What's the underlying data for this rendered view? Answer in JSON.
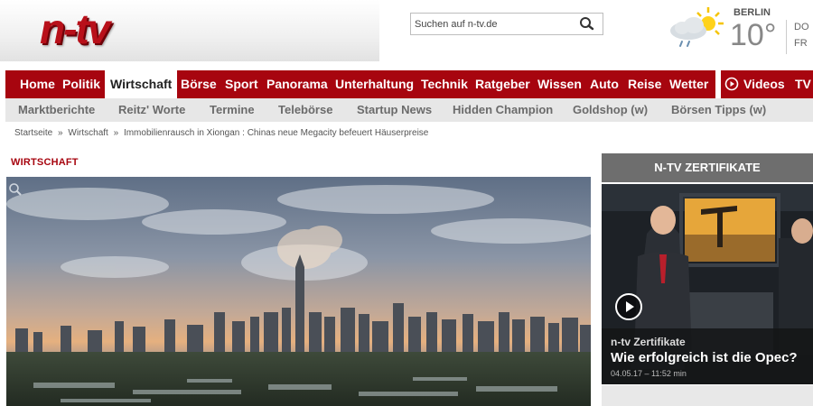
{
  "header": {
    "logo_text": "n-tv",
    "search": {
      "placeholder": "Suchen auf n-tv.de",
      "value": ""
    },
    "weather": {
      "city": "BERLIN",
      "temp": "10°",
      "day1": "DO",
      "day2": "FR",
      "icon": "partly-cloudy-rain-icon"
    }
  },
  "nav": {
    "items": [
      {
        "label": "Home"
      },
      {
        "label": "Politik"
      },
      {
        "label": "Wirtschaft",
        "active": true
      },
      {
        "label": "Börse"
      },
      {
        "label": "Sport"
      },
      {
        "label": "Panorama"
      },
      {
        "label": "Unterhaltung"
      },
      {
        "label": "Technik"
      },
      {
        "label": "Ratgeber"
      },
      {
        "label": "Wissen"
      },
      {
        "label": "Auto"
      },
      {
        "label": "Reise"
      },
      {
        "label": "Wetter"
      },
      {
        "label": "Videos"
      },
      {
        "label": "TV"
      }
    ]
  },
  "subnav": {
    "items": [
      {
        "label": "Marktberichte"
      },
      {
        "label": "Reitz' Worte"
      },
      {
        "label": "Termine"
      },
      {
        "label": "Telebörse"
      },
      {
        "label": "Startup News"
      },
      {
        "label": "Hidden Champion"
      },
      {
        "label": "Goldshop (w)"
      },
      {
        "label": "Börsen Tipps (w)"
      }
    ]
  },
  "breadcrumb": {
    "items": [
      "Startseite",
      "Wirtschaft",
      "Immobilienrausch in Xiongan : Chinas neue Megacity befeuert Häuserpreise"
    ],
    "separator": "»"
  },
  "content": {
    "section_label": "WIRTSCHAFT"
  },
  "sidebar": {
    "title": "N-TV ZERTIFIKATE",
    "kicker": "n-tv Zertifikate",
    "headline": "Wie erfolgreich ist die Opec?",
    "meta": "04.05.17 – 11:52 min"
  },
  "colors": {
    "brand_red": "#a7050f",
    "subnav_bg": "#e7e7e7",
    "sidebar_head": "#6e6e6e"
  }
}
